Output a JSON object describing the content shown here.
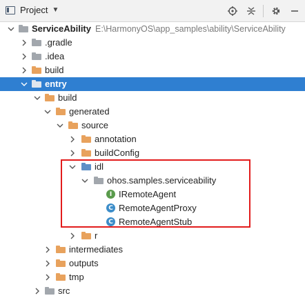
{
  "toolbar": {
    "title": "Project",
    "icons": [
      "locate-icon",
      "collapse-all-icon",
      "settings-icon",
      "minimize-icon"
    ]
  },
  "colors": {
    "selection": "#2f7fd1",
    "folder": "#e8a25d",
    "excluded_folder": "#a2a7ad",
    "interface_icon": "#5a9b4c",
    "class_icon": "#3c8dc9",
    "highlight_box": "#e21b1b"
  },
  "tree": {
    "root": {
      "name": "ServiceAbility",
      "path": "E:\\HarmonyOS\\app_samples\\ability\\ServiceAbility"
    },
    "gradle": ".gradle",
    "idea": ".idea",
    "build_root": "build",
    "entry": "entry",
    "entry_build": "build",
    "generated": "generated",
    "source": "source",
    "annotation": "annotation",
    "buildConfig": "buildConfig",
    "idl": "idl",
    "package": "ohos.samples.serviceability",
    "iremote_agent": "IRemoteAgent",
    "remote_agent_proxy": "RemoteAgentProxy",
    "remote_agent_stub": "RemoteAgentStub",
    "r": "r",
    "intermediates": "intermediates",
    "outputs": "outputs",
    "tmp": "tmp",
    "src": "src"
  }
}
